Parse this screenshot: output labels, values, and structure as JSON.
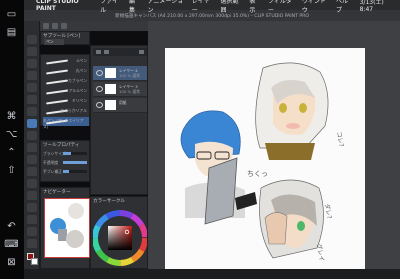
{
  "device": {
    "clock": "3/13(土) 8:47"
  },
  "menubar": {
    "apple_icon": "apple-icon",
    "app_name": "CLIP STUDIO PAINT",
    "menus": [
      "ファイル",
      "編集",
      "アニメーション",
      "レイヤー",
      "選択範囲",
      "表示",
      "フィルター",
      "ウィンドウ",
      "ヘルプ"
    ],
    "doc_title": "新規描画キャンバス (A4 210.00 x 297.00mm 300dpi 35.0%) – CLIP STUDIO PAINT PRO"
  },
  "subtool_panel": {
    "title": "サブツール [ペン]",
    "tab": "ペン",
    "brushes": [
      "Gペン",
      "丸ペン",
      "カブラペン",
      "リアルGペン",
      "ミリペン",
      "なめらかリアル",
      "丸ペン (アンチエイリアス)"
    ]
  },
  "tool_property": {
    "title": "ツールプロパティ",
    "rows": [
      {
        "label": "ブラシサイズ",
        "value": 0.35
      },
      {
        "label": "不透明度",
        "value": 1.0
      },
      {
        "label": "手ブレ補正",
        "value": 0.25
      }
    ]
  },
  "navigator": {
    "title": "ナビゲーター"
  },
  "layers": {
    "items": [
      {
        "name": "レイヤー 4",
        "mode": "100 % 通常",
        "selected": true
      },
      {
        "name": "レイヤー 3",
        "mode": "100 % 通常",
        "selected": false
      },
      {
        "name": "用紙",
        "mode": "",
        "selected": false
      }
    ]
  },
  "color": {
    "title": "カラーサークル",
    "main_color": "#8a1512"
  },
  "canvas": {
    "annotations": [
      "ちくっ",
      "コレ?",
      "ダレ?",
      "グレイ"
    ]
  },
  "colors": {
    "accent": "#4a79b8",
    "panel": "#2f3033",
    "canvas_bg": "#3f4044",
    "paper": "#fbfbfb"
  }
}
